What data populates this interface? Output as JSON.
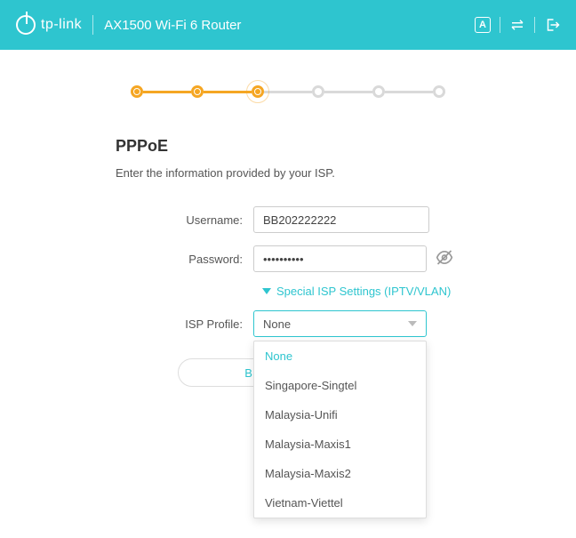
{
  "header": {
    "brand": "tp-link",
    "product": "AX1500 Wi-Fi 6 Router"
  },
  "stepper": {
    "total": 6,
    "completed": 3,
    "current_index": 2
  },
  "page": {
    "title": "PPPoE",
    "subtitle": "Enter the information provided by your ISP."
  },
  "form": {
    "username_label": "Username:",
    "username_value": "BB202222222",
    "password_label": "Password:",
    "password_value": "••••••••••",
    "special_link": "Special ISP Settings (IPTV/VLAN)",
    "isp_profile_label": "ISP Profile:",
    "isp_profile_value": "None",
    "isp_options": [
      "None",
      "Singapore-Singtel",
      "Malaysia-Unifi",
      "Malaysia-Maxis1",
      "Malaysia-Maxis2",
      "Vietnam-Viettel"
    ]
  },
  "buttons": {
    "back": "BACK"
  }
}
